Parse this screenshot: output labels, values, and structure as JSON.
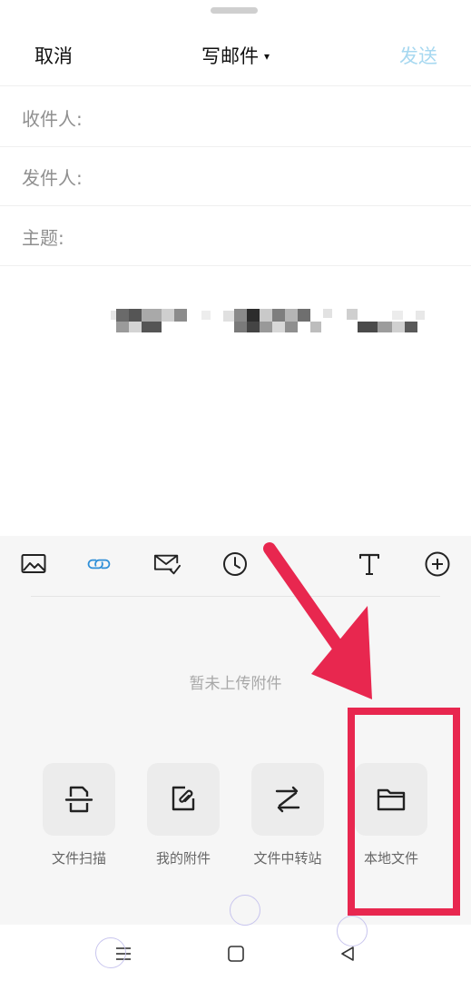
{
  "header": {
    "cancel_label": "取消",
    "title": "写邮件",
    "title_caret": "▾",
    "send_label": "发送"
  },
  "fields": {
    "to_label": "收件人:",
    "from_label": "发件人:",
    "subject_label": "主题:"
  },
  "toolbar": {
    "icons": [
      "image-icon",
      "link-icon",
      "mail-check-icon",
      "clock-icon",
      "text-format-icon",
      "add-icon"
    ]
  },
  "attachments": {
    "empty_text": "暂未上传附件",
    "options": [
      {
        "label": "文件扫描",
        "icon": "file-scan-icon"
      },
      {
        "label": "我的附件",
        "icon": "my-attachment-icon"
      },
      {
        "label": "文件中转站",
        "icon": "file-transfer-icon"
      },
      {
        "label": "本地文件",
        "icon": "folder-icon"
      }
    ]
  },
  "colors": {
    "accent_send_disabled": "#a7d8f0",
    "link_icon_blue": "#2f8fd8",
    "annotation_red": "#e8274f"
  }
}
